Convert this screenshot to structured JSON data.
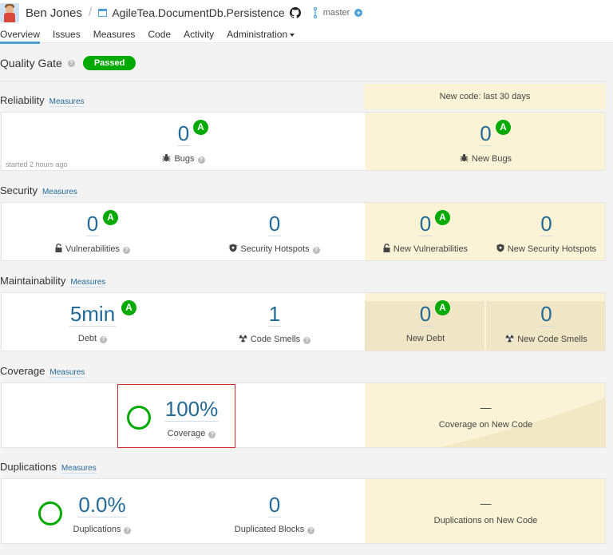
{
  "header": {
    "user": "Ben Jones",
    "separator": "/",
    "project": "AgileTea.DocumentDb.Persistence",
    "branch": "master",
    "tabs": [
      {
        "label": "Overview",
        "active": true
      },
      {
        "label": "Issues",
        "active": false
      },
      {
        "label": "Measures",
        "active": false
      },
      {
        "label": "Code",
        "active": false
      },
      {
        "label": "Activity",
        "active": false
      },
      {
        "label": "Administration",
        "active": false
      }
    ]
  },
  "quality_gate": {
    "title": "Quality Gate",
    "status": "Passed",
    "status_color": "#00aa00"
  },
  "new_code_period": "New code: last 30 days",
  "measures_link": "Measures",
  "help_glyph": "?",
  "reliability": {
    "title": "Reliability",
    "bugs": {
      "value": "0",
      "rating": "A",
      "label": "Bugs"
    },
    "started": "started 2 hours ago",
    "new_bugs": {
      "value": "0",
      "rating": "A",
      "label": "New Bugs"
    }
  },
  "security": {
    "title": "Security",
    "vulnerabilities": {
      "value": "0",
      "rating": "A",
      "label": "Vulnerabilities"
    },
    "hotspots": {
      "value": "0",
      "label": "Security Hotspots"
    },
    "new_vulnerabilities": {
      "value": "0",
      "rating": "A",
      "label": "New Vulnerabilities"
    },
    "new_hotspots": {
      "value": "0",
      "label": "New Security Hotspots"
    }
  },
  "maintainability": {
    "title": "Maintainability",
    "debt": {
      "value": "5min",
      "rating": "A",
      "label": "Debt"
    },
    "code_smells": {
      "value": "1",
      "label": "Code Smells"
    },
    "new_debt": {
      "value": "0",
      "rating": "A",
      "label": "New Debt"
    },
    "new_code_smells": {
      "value": "0",
      "label": "New Code Smells"
    }
  },
  "coverage": {
    "title": "Coverage",
    "coverage": {
      "value": "100%",
      "label": "Coverage"
    },
    "new_coverage": {
      "value": "—",
      "label": "Coverage on New Code"
    }
  },
  "duplications": {
    "title": "Duplications",
    "duplications": {
      "value": "0.0%",
      "label": "Duplications"
    },
    "duplicated_blocks": {
      "value": "0",
      "label": "Duplicated Blocks"
    },
    "new_duplications": {
      "value": "—",
      "label": "Duplications on New Code"
    }
  },
  "colors": {
    "accent": "#236a97",
    "rating_a": "#00aa00",
    "new_code_bg": "#fbf3d5",
    "highlight": "#d42a2a"
  }
}
